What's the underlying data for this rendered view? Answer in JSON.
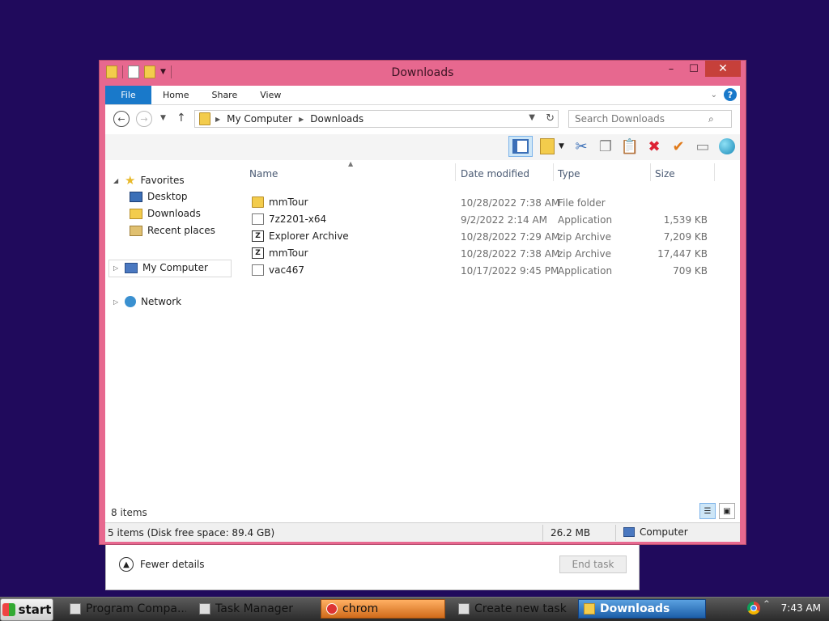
{
  "taskmanager": {
    "fewer_details": "Fewer details",
    "end_task": "End task"
  },
  "window": {
    "title": "Downloads",
    "controls": {
      "minimize": "–",
      "maximize": "☐",
      "close": "✕"
    }
  },
  "ribbon": {
    "tabs": [
      {
        "label": "File"
      },
      {
        "label": "Home"
      },
      {
        "label": "Share"
      },
      {
        "label": "View"
      }
    ]
  },
  "address": {
    "crumbs": [
      "My Computer",
      "Downloads"
    ]
  },
  "search": {
    "placeholder": "Search Downloads"
  },
  "nav": {
    "favorites": "Favorites",
    "desktop": "Desktop",
    "downloads": "Downloads",
    "recent": "Recent places",
    "my_computer": "My Computer",
    "network": "Network"
  },
  "columns": {
    "name": "Name",
    "date": "Date modified",
    "type": "Type",
    "size": "Size"
  },
  "files": [
    {
      "name": "mmTour",
      "date": "10/28/2022 7:38 AM",
      "type": "File folder",
      "size": "",
      "icon": "folder-icon"
    },
    {
      "name": "7z2201-x64",
      "date": "9/2/2022 2:14 AM",
      "type": "Application",
      "size": "1,539 KB",
      "icon": "application-icon"
    },
    {
      "name": "Explorer Archive",
      "date": "10/28/2022 7:29 AM",
      "type": "zip Archive",
      "size": "7,209 KB",
      "icon": "zip-archive-icon"
    },
    {
      "name": "mmTour",
      "date": "10/28/2022 7:38 AM",
      "type": "zip Archive",
      "size": "17,447 KB",
      "icon": "zip-archive-icon"
    },
    {
      "name": "vac467",
      "date": "10/17/2022 9:45 PM",
      "type": "Application",
      "size": "709 KB",
      "icon": "application-icon"
    }
  ],
  "view": {
    "item_count": "8 items"
  },
  "status": {
    "selection": "5 items (Disk free space: 89.4 GB)",
    "size": "26.2 MB",
    "location": "Computer"
  },
  "taskbar": {
    "start": "start",
    "tasks": [
      {
        "label": "Program Compa..."
      },
      {
        "label": "Task Manager"
      },
      {
        "label": "chrom"
      },
      {
        "label": "Create new task"
      },
      {
        "label": "Downloads"
      }
    ],
    "clock": "7:43 AM"
  }
}
